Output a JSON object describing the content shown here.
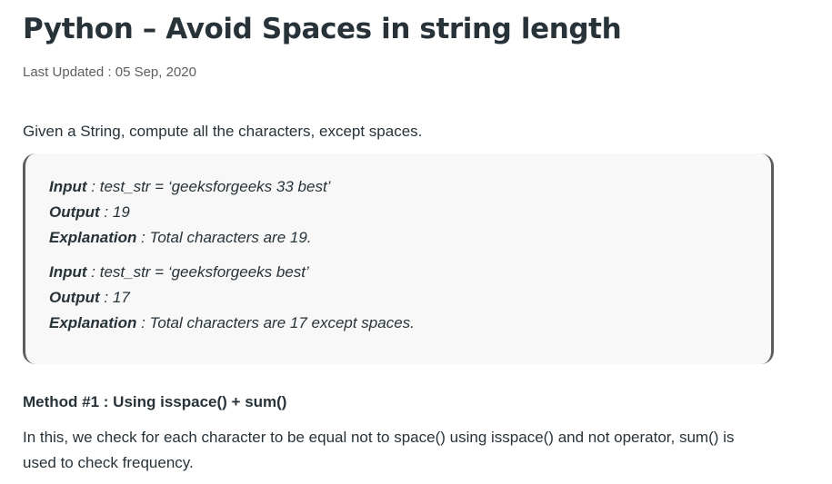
{
  "article": {
    "title": "Python – Avoid Spaces in string length",
    "last_updated": "Last Updated : 05 Sep, 2020",
    "intro": "Given a String, compute all the characters, except spaces.",
    "examples": [
      {
        "input_label": "Input",
        "input_value": " : test_str = ‘geeksforgeeks 33 best’",
        "output_label": "Output",
        "output_value": " : 19",
        "explanation_label": "Explanation",
        "explanation_value": " : Total characters are 19."
      },
      {
        "input_label": "Input",
        "input_value": " : test_str = ‘geeksforgeeks best’",
        "output_label": "Output",
        "output_value": " : 17",
        "explanation_label": "Explanation",
        "explanation_value": " : Total characters are 17 except spaces."
      }
    ],
    "method_heading": "Method #1 : Using isspace() + sum()",
    "method_description": "In this, we check for each character to be equal not to space() using isspace() and not operator, sum() is used to check frequency."
  }
}
